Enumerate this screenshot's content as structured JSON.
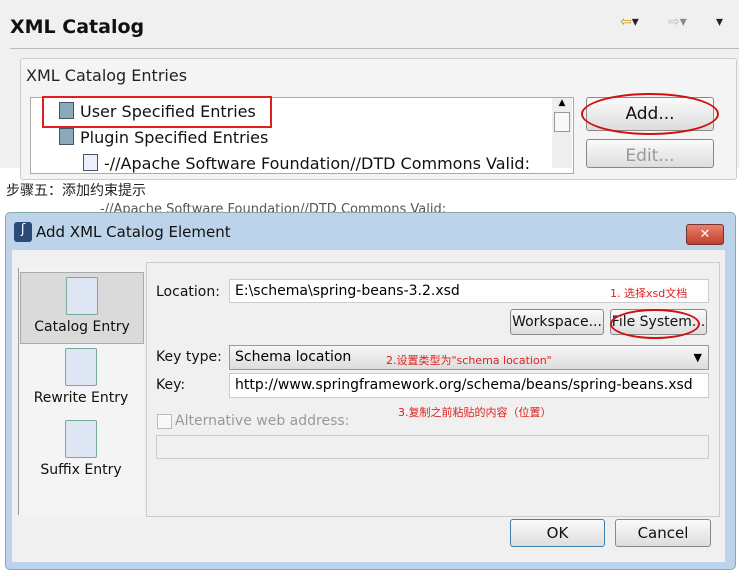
{
  "panel": {
    "title": "XML Catalog",
    "group_label": "XML Catalog Entries",
    "entries": [
      "User Specified Entries",
      "Plugin Specified Entries",
      "-//Apache Software Foundation//DTD Commons Valid:"
    ],
    "add_label": "Add...",
    "edit_label": "Edit..."
  },
  "caption": "步骤五：添加约束提示",
  "fragment": "-//Apache Software Foundation//DTD Commons Valid:",
  "dialog": {
    "title": "Add XML Catalog Element",
    "close_label": "✕",
    "nav": [
      "Catalog Entry",
      "Rewrite Entry",
      "Suffix Entry"
    ],
    "location_label": "Location:",
    "location_value": "E:\\schema\\spring-beans-3.2.xsd",
    "workspace_label": "Workspace...",
    "filesystem_label": "File System...",
    "keytype_label": "Key type:",
    "keytype_value": "Schema location",
    "key_label": "Key:",
    "key_value": "http://www.springframework.org/schema/beans/spring-beans.xsd",
    "alt_label": "Alternative web address:",
    "alt_value": "",
    "ok_label": "OK",
    "cancel_label": "Cancel"
  },
  "annotations": {
    "note1": "1. 选择xsd文档",
    "note2": "2.设置类型为\"schema location\"",
    "note3": "3.复制之前粘贴的内容（位置）"
  },
  "colors": {
    "annotation": "#e02020",
    "titlebar": "#bcd3ea"
  }
}
